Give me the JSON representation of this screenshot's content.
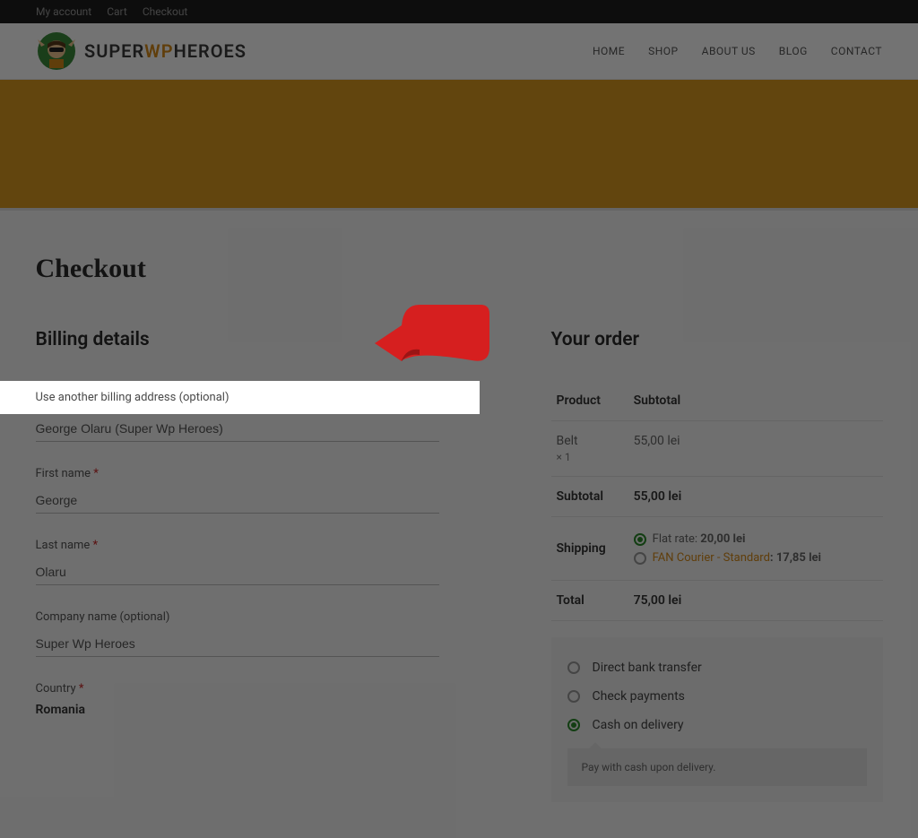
{
  "topbar": {
    "my_account": "My account",
    "cart": "Cart",
    "checkout": "Checkout"
  },
  "logo": {
    "pre": "SUPER",
    "mid": "WP",
    "post": "HEROES"
  },
  "nav": {
    "home": "HOME",
    "shop": "SHOP",
    "about": "ABOUT US",
    "blog": "BLOG",
    "contact": "CONTACT"
  },
  "page_title": "Checkout",
  "billing": {
    "heading": "Billing details",
    "use_another": "Use another billing address (optional)",
    "full_name_value": "George Olaru (Super Wp Heroes)",
    "first_name_label": "First name",
    "first_name_value": "George",
    "last_name_label": "Last name",
    "last_name_value": "Olaru",
    "company_label": "Company name (optional)",
    "company_value": "Super Wp Heroes",
    "country_label": "Country",
    "country_value": "Romania"
  },
  "order": {
    "heading": "Your order",
    "product_h": "Product",
    "subtotal_h": "Subtotal",
    "item_name": "Belt",
    "item_qty": "× 1",
    "item_price": "55,00 lei",
    "subtotal_label": "Subtotal",
    "subtotal_value": "55,00 lei",
    "shipping_label": "Shipping",
    "flat_label": "Flat rate: ",
    "flat_price": "20,00 lei",
    "fan_label": "FAN Courier - Standard",
    "fan_price": ": 17,85 lei",
    "total_label": "Total",
    "total_value": "75,00 lei"
  },
  "payment": {
    "bank": "Direct bank transfer",
    "check": "Check payments",
    "cod": "Cash on delivery",
    "cod_desc": "Pay with cash upon delivery."
  }
}
